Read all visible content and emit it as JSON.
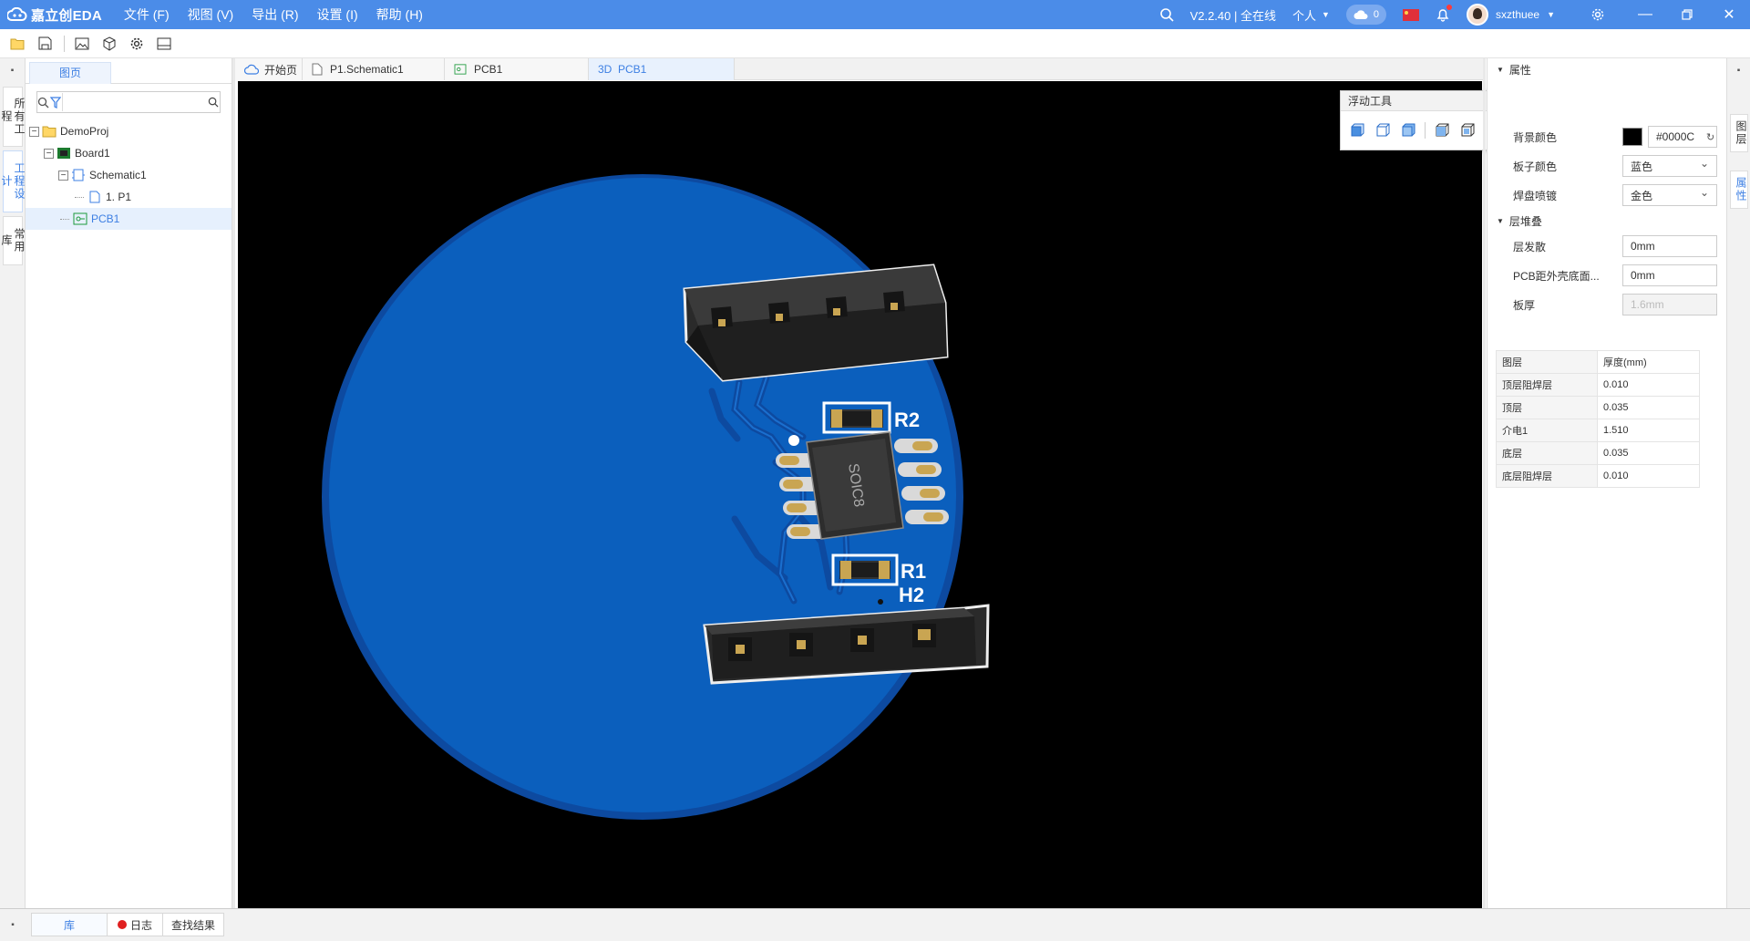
{
  "app": {
    "logo_text": "嘉立创EDA",
    "menus": [
      "文件 (F)",
      "视图 (V)",
      "导出 (R)",
      "设置 (I)",
      "帮助 (H)"
    ],
    "version": "V2.2.40 | 全在线",
    "account": "个人",
    "cloud_count": "0",
    "username": "sxzthuee",
    "brand_color": "#4b8ce8"
  },
  "left_rail": {
    "tabs": [
      "所有工程",
      "工程设计",
      "常用库"
    ]
  },
  "left_panel": {
    "tab": "图页",
    "search_placeholder": "",
    "tree": [
      {
        "label": "DemoProj",
        "icon": "folder-icon"
      },
      {
        "label": "Board1",
        "icon": "board-icon"
      },
      {
        "label": "Schematic1",
        "icon": "schematic-icon"
      },
      {
        "label": "1. P1",
        "icon": "page-icon"
      },
      {
        "label": "PCB1",
        "icon": "pcb-icon"
      }
    ]
  },
  "doc_tabs": [
    {
      "label": "开始页",
      "icon": "cloud-home-icon"
    },
    {
      "label": "P1.Schematic1",
      "icon": "page-icon"
    },
    {
      "label": "PCB1",
      "icon": "pcb-icon"
    },
    {
      "label": "3D  PCB1",
      "icon": ""
    }
  ],
  "float_tool": {
    "title": "浮动工具"
  },
  "viewer": {
    "designators": [
      "R2",
      "R1",
      "H2"
    ],
    "chip_label": "SOIC8",
    "board_color": "#0b5fbd",
    "background_color": "#000000"
  },
  "properties": {
    "section_props": "属性",
    "bg_color_label": "背景颜色",
    "bg_color_value": "#0000C",
    "board_color_label": "板子颜色",
    "board_color_value": "蓝色",
    "pad_finish_label": "焊盘喷镀",
    "pad_finish_value": "金色",
    "section_stack": "层堆叠",
    "layer_spread_label": "层发散",
    "layer_spread_value": "0mm",
    "pcb_offset_label": "PCB距外壳底面...",
    "pcb_offset_value": "0mm",
    "thickness_label": "板厚",
    "thickness_value": "1.6mm",
    "table_headers": [
      "图层",
      "厚度(mm)"
    ],
    "table_rows": [
      [
        "顶层阻焊层",
        "0.010"
      ],
      [
        "顶层",
        "0.035"
      ],
      [
        "介电1",
        "1.510"
      ],
      [
        "底层",
        "0.035"
      ],
      [
        "底层阻焊层",
        "0.010"
      ]
    ]
  },
  "right_rail": {
    "tabs": [
      "图层",
      "属性"
    ]
  },
  "bottom": {
    "tabs": [
      "库",
      "日志",
      "查找结果"
    ]
  }
}
